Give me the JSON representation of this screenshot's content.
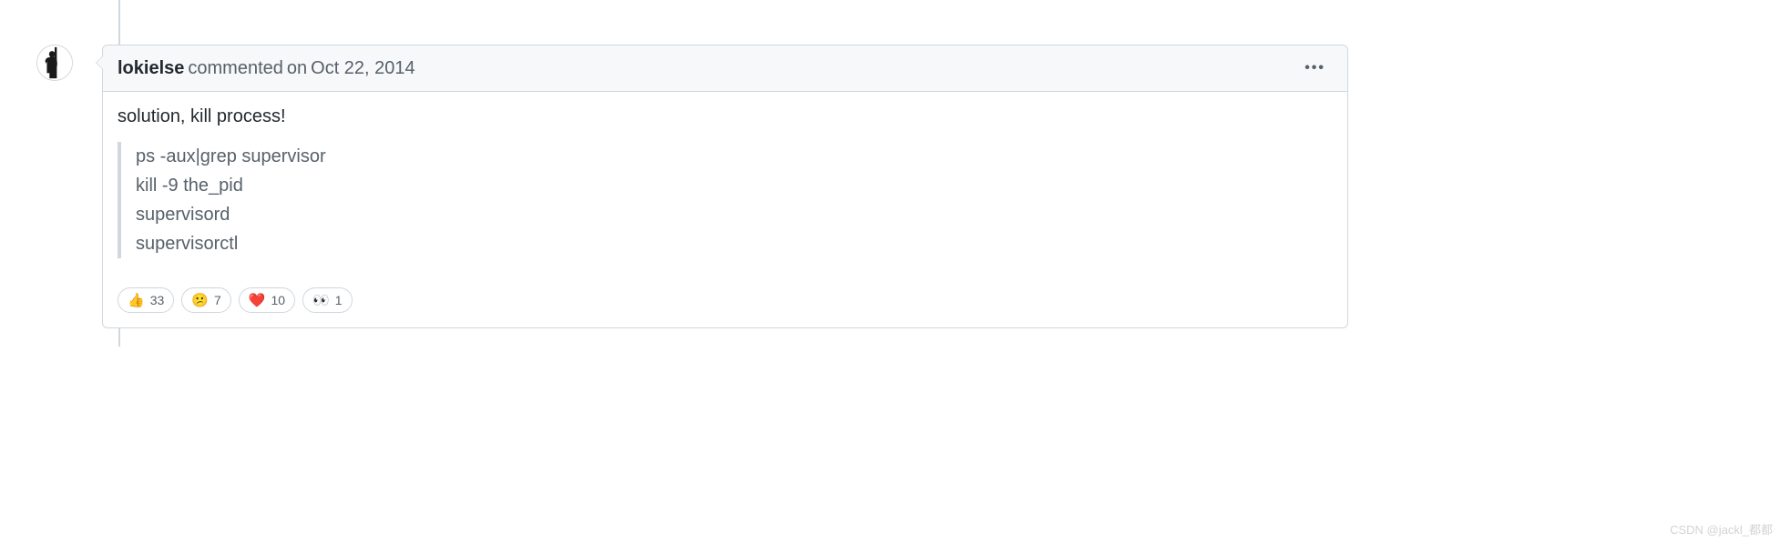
{
  "comment": {
    "author": "lokielse",
    "action": "commented",
    "date_prefix": "on",
    "date": "Oct 22, 2014",
    "body_text": "solution, kill process!",
    "code_lines": [
      "ps -aux|grep supervisor",
      "kill -9 the_pid",
      "supervisord",
      "supervisorctl"
    ]
  },
  "reactions": [
    {
      "emoji": "👍",
      "count": "33"
    },
    {
      "emoji": "😕",
      "count": "7"
    },
    {
      "emoji": "❤️",
      "count": "10"
    },
    {
      "emoji": "👀",
      "count": "1"
    }
  ],
  "watermark": "CSDN @jackl_都都"
}
